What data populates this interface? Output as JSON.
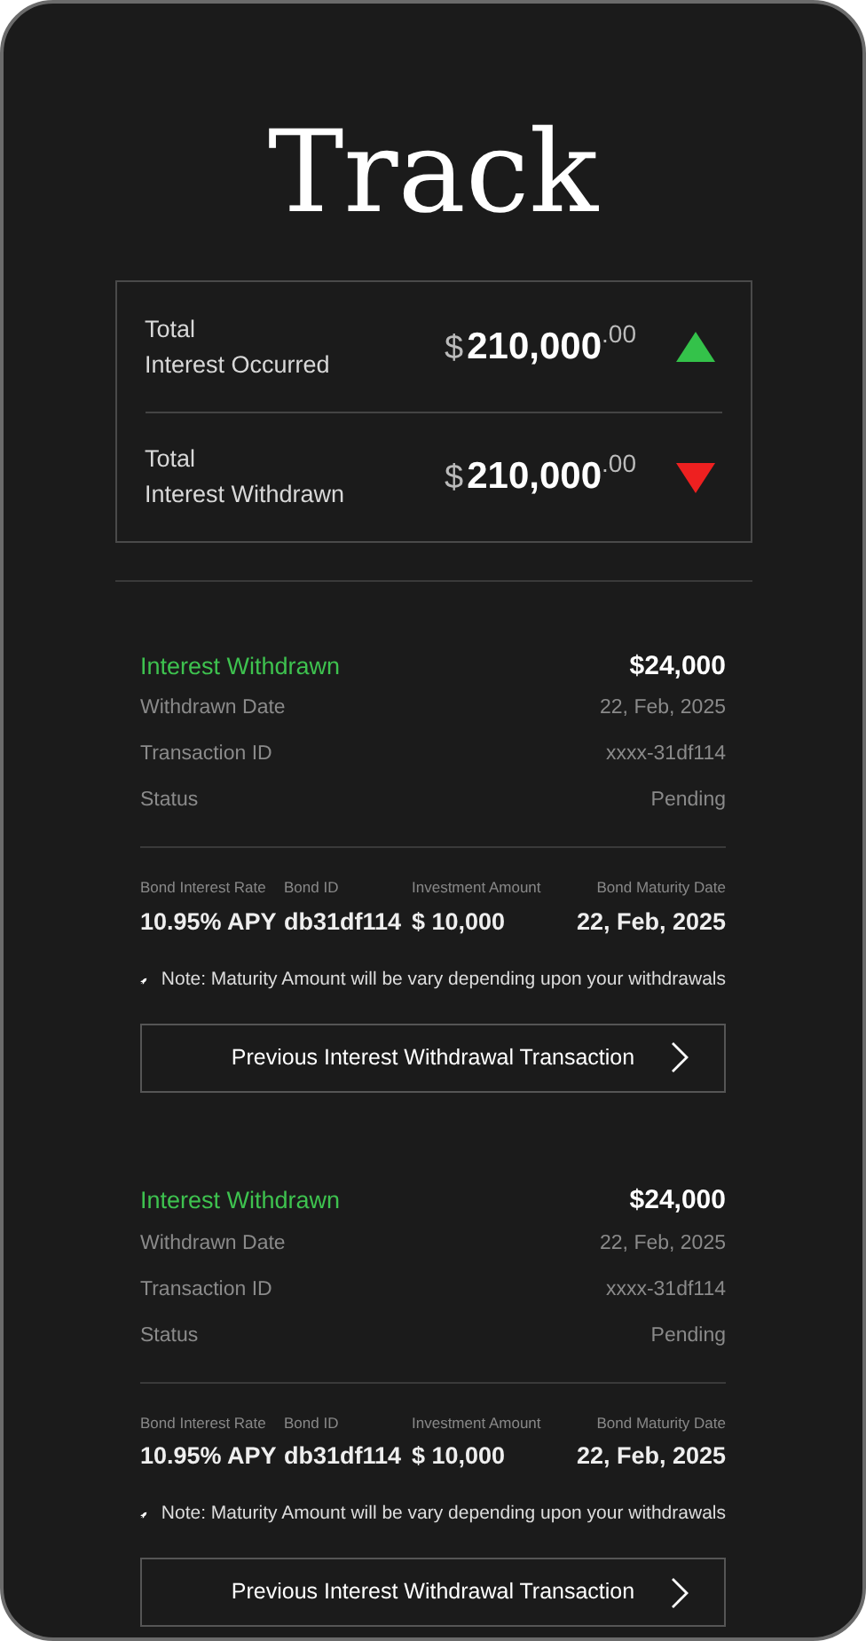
{
  "title": "Track",
  "summary": [
    {
      "label_line1": "Total",
      "label_line2": "Interest Occurred",
      "currency": "$",
      "amount": "210,000",
      "cents": ".00",
      "increase": true
    },
    {
      "label_line1": "Total",
      "label_line2": "Interest Withdrawn",
      "currency": "$",
      "amount": "210,000",
      "cents": ".00",
      "increase": false
    }
  ],
  "transactions": [
    {
      "heading": "Interest Withdrawn",
      "amount": "$24,000",
      "details": [
        {
          "label": "Withdrawn Date",
          "value": "22, Feb, 2025"
        },
        {
          "label": "Transaction ID",
          "value": "xxxx-31df114"
        },
        {
          "label": "Status",
          "value": "Pending"
        }
      ],
      "bond": [
        {
          "label": "Bond Interest Rate",
          "value": "10.95% APY"
        },
        {
          "label": "Bond ID",
          "value": "db31df114"
        },
        {
          "label": "Investment Amount",
          "value": "$ 10,000"
        },
        {
          "label": "Bond Maturity Date",
          "value": "22, Feb, 2025"
        }
      ],
      "note": "Note: Maturity Amount will be vary depending upon your withdrawals",
      "button": "Previous Interest Withdrawal Transaction"
    },
    {
      "heading": "Interest Withdrawn",
      "amount": "$24,000",
      "details": [
        {
          "label": "Withdrawn Date",
          "value": "22, Feb, 2025"
        },
        {
          "label": "Transaction ID",
          "value": "xxxx-31df114"
        },
        {
          "label": "Status",
          "value": "Pending"
        }
      ],
      "bond": [
        {
          "label": "Bond Interest Rate",
          "value": "10.95% APY"
        },
        {
          "label": "Bond ID",
          "value": "db31df114"
        },
        {
          "label": "Investment Amount",
          "value": "$ 10,000"
        },
        {
          "label": "Bond Maturity Date",
          "value": "22, Feb, 2025"
        }
      ],
      "note": "Note: Maturity Amount will be vary depending upon your withdrawals",
      "button": "Previous Interest Withdrawal Transaction"
    }
  ]
}
